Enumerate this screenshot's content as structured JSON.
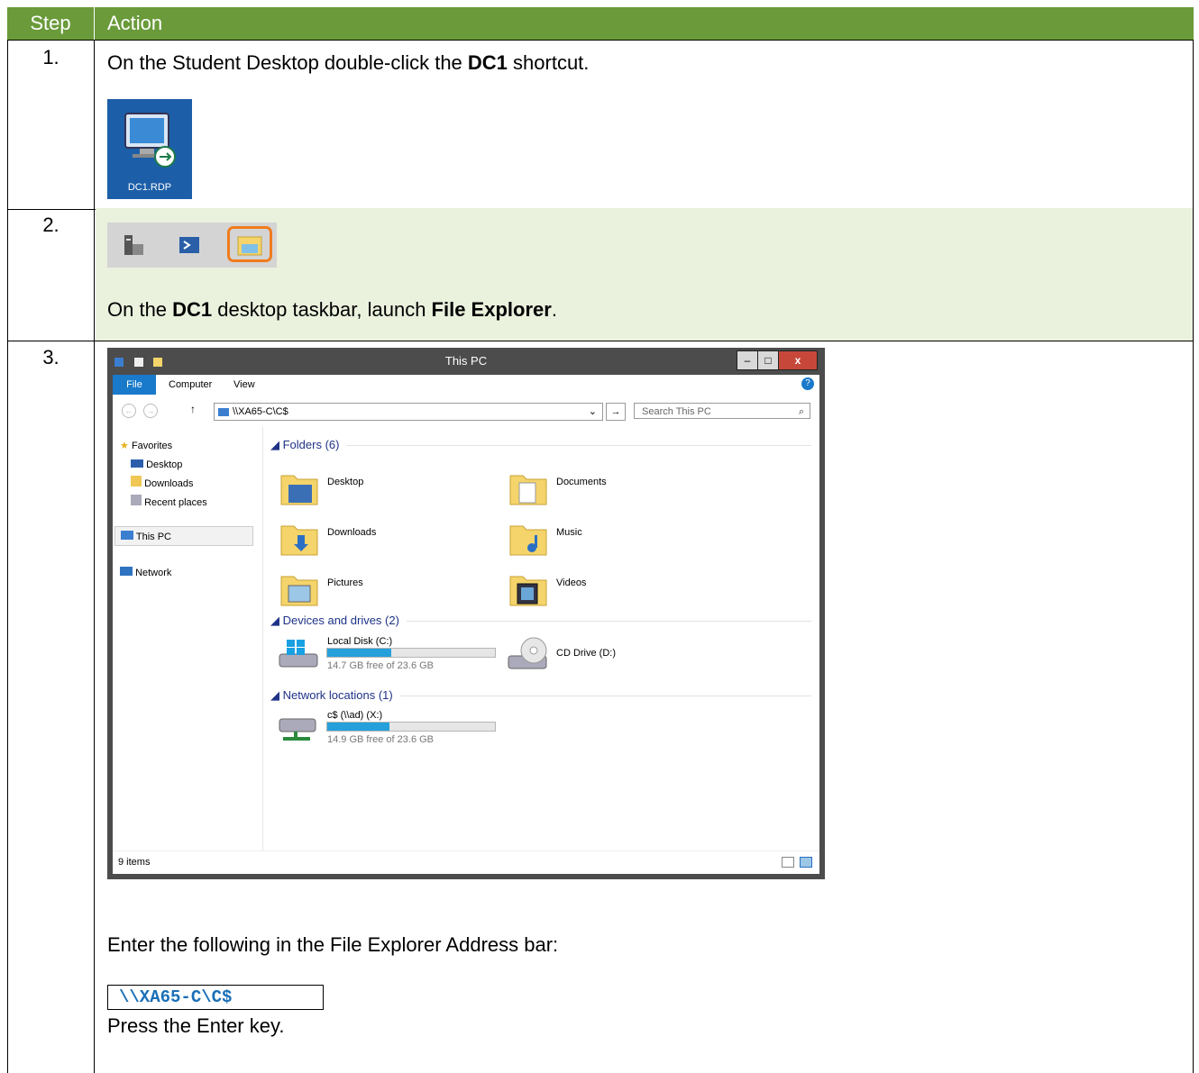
{
  "header": {
    "step_label": "Step",
    "action_label": "Action"
  },
  "steps": [
    {
      "number": "1.",
      "text_pre": "On the Student Desktop double-click the ",
      "text_bold": "DC1",
      "text_post": " shortcut.",
      "shortcut_label": "DC1.RDP"
    },
    {
      "number": "2.",
      "text_pre": "On the ",
      "text_bold1": "DC1",
      "text_mid": " desktop taskbar, launch ",
      "text_bold2": "File Explorer",
      "text_post": "."
    },
    {
      "number": "3.",
      "instruction": "Enter the following in the File Explorer Address bar:",
      "code": "\\\\XA65-C\\C$",
      "press": "Press the Enter key."
    }
  ],
  "explorer": {
    "title": "This PC",
    "ribbon_tabs": [
      "File",
      "Computer",
      "View"
    ],
    "address": "\\\\XA65-C\\C$",
    "search_placeholder": "Search This PC",
    "nav": {
      "favorites": "Favorites",
      "desktop": "Desktop",
      "downloads": "Downloads",
      "recent": "Recent places",
      "this_pc": "This PC",
      "network": "Network"
    },
    "sections": {
      "folders": "Folders (6)",
      "devices": "Devices and drives (2)",
      "network": "Network locations (1)"
    },
    "folders": [
      "Desktop",
      "Documents",
      "Downloads",
      "Music",
      "Pictures",
      "Videos"
    ],
    "drives": [
      {
        "name": "Local Disk (C:)",
        "free": "14.7 GB free of 23.6 GB",
        "used_fraction": 0.38
      },
      {
        "name": "CD Drive (D:)"
      }
    ],
    "network_locations": [
      {
        "name": "c$ (\\\\ad) (X:)",
        "free": "14.9 GB free of 23.6 GB",
        "used_fraction": 0.37
      }
    ],
    "status": "9 items",
    "colors": {
      "accent": "#1979ca",
      "bar": "#26a0da",
      "header_green": "#6a9a3a",
      "row2_bg": "#eaf1dd"
    }
  }
}
